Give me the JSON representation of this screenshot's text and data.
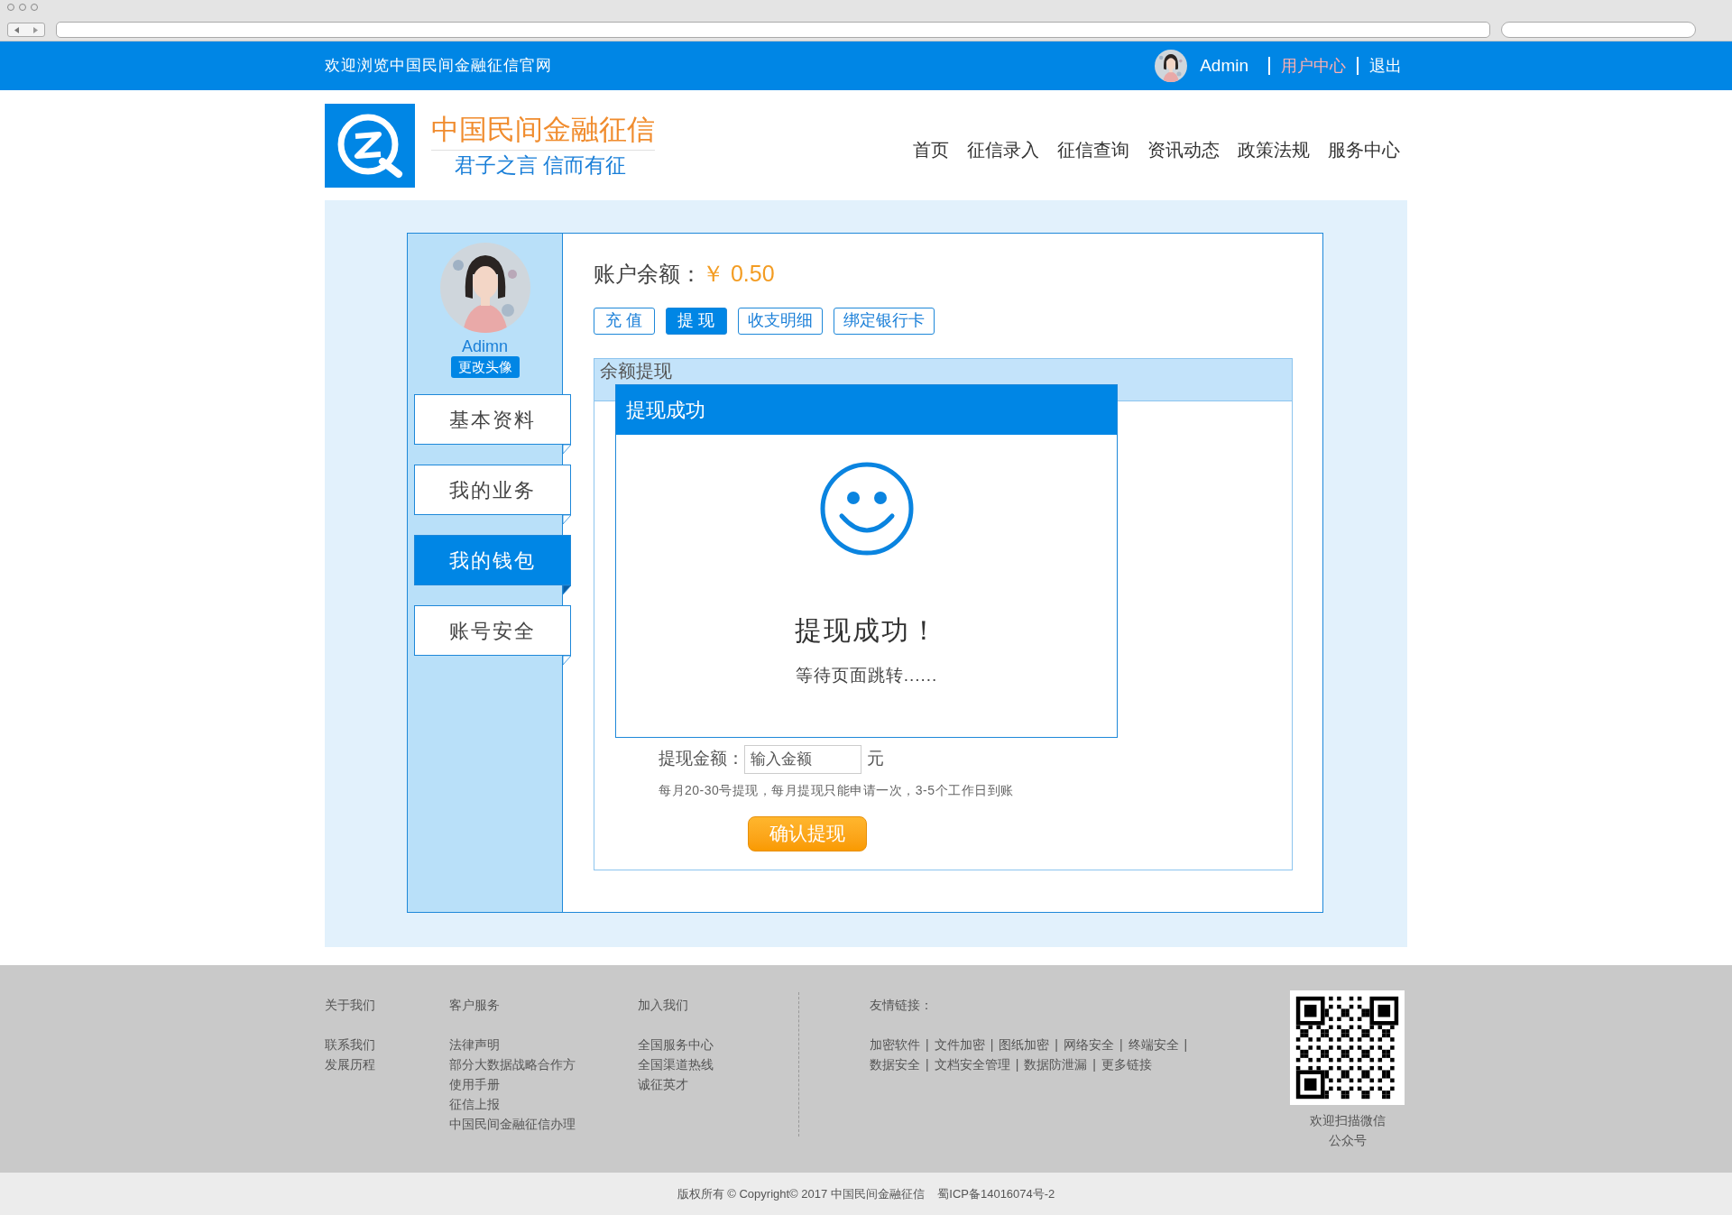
{
  "top_bar": {
    "welcome": "欢迎浏览中国民间金融征信官网",
    "user_name": "Admin",
    "links": [
      {
        "label": "用户中心",
        "selected": true
      },
      {
        "label": "退出",
        "selected": false
      }
    ]
  },
  "header": {
    "title": "中国民间金融征信",
    "slogan": "君子之言 信而有征",
    "nav": [
      {
        "label": "首页"
      },
      {
        "label": "征信录入"
      },
      {
        "label": "征信查询"
      },
      {
        "label": "资讯动态"
      },
      {
        "label": "政策法规"
      },
      {
        "label": "服务中心"
      }
    ]
  },
  "sidebar": {
    "user_name": "Adimn",
    "change_avatar": "更改头像",
    "items": [
      {
        "label": "基本资料",
        "selected": false
      },
      {
        "label": "我的业务",
        "selected": false
      },
      {
        "label": "我的钱包",
        "selected": true
      },
      {
        "label": "账号安全",
        "selected": false
      }
    ]
  },
  "account": {
    "balance_label": "账户余额：",
    "balance": "￥ 0.50",
    "actions": [
      {
        "label": "充 值",
        "selected": false
      },
      {
        "label": "提 现",
        "selected": true
      },
      {
        "label": "收支明细",
        "selected": false
      },
      {
        "label": "绑定银行卡",
        "selected": false
      }
    ]
  },
  "withdraw_panel": {
    "title": "余额提现",
    "amount_label": "提现金额：",
    "amount_field": {
      "placeholder": "输入金额"
    },
    "unit": "元",
    "note": "每月20-30号提现，每月提现只能申请一次，3-5个工作日到账",
    "confirm": "确认提现"
  },
  "dialog": {
    "title": "提现成功",
    "message": "提现成功！",
    "sub_message": "等待页面跳转......"
  },
  "footer": {
    "columns": [
      {
        "heading": "关于我们",
        "links": [
          "联系我们",
          "发展历程"
        ]
      },
      {
        "heading": "客户服务",
        "links": [
          "法律声明",
          "部分大数据战略合作方",
          "使用手册",
          "征信上报",
          "中国民间金融征信办理"
        ]
      },
      {
        "heading": "加入我们",
        "links": [
          "全国服务中心",
          "全国渠道热线",
          "诚征英才"
        ]
      }
    ],
    "friend_links": {
      "heading": "友情链接：",
      "rows": [
        [
          "加密软件",
          "文件加密",
          "图纸加密",
          "网络安全",
          "终端安全"
        ],
        [
          "数据安全",
          "文档安全管理",
          "数据防泄漏",
          "更多链接"
        ]
      ],
      "separator": "|"
    },
    "qr_caption": "欢迎扫描微信公众号",
    "copyright": "版权所有 © Copyright© 2017 中国民间金融征信    蜀ICP备14016074号-2"
  }
}
